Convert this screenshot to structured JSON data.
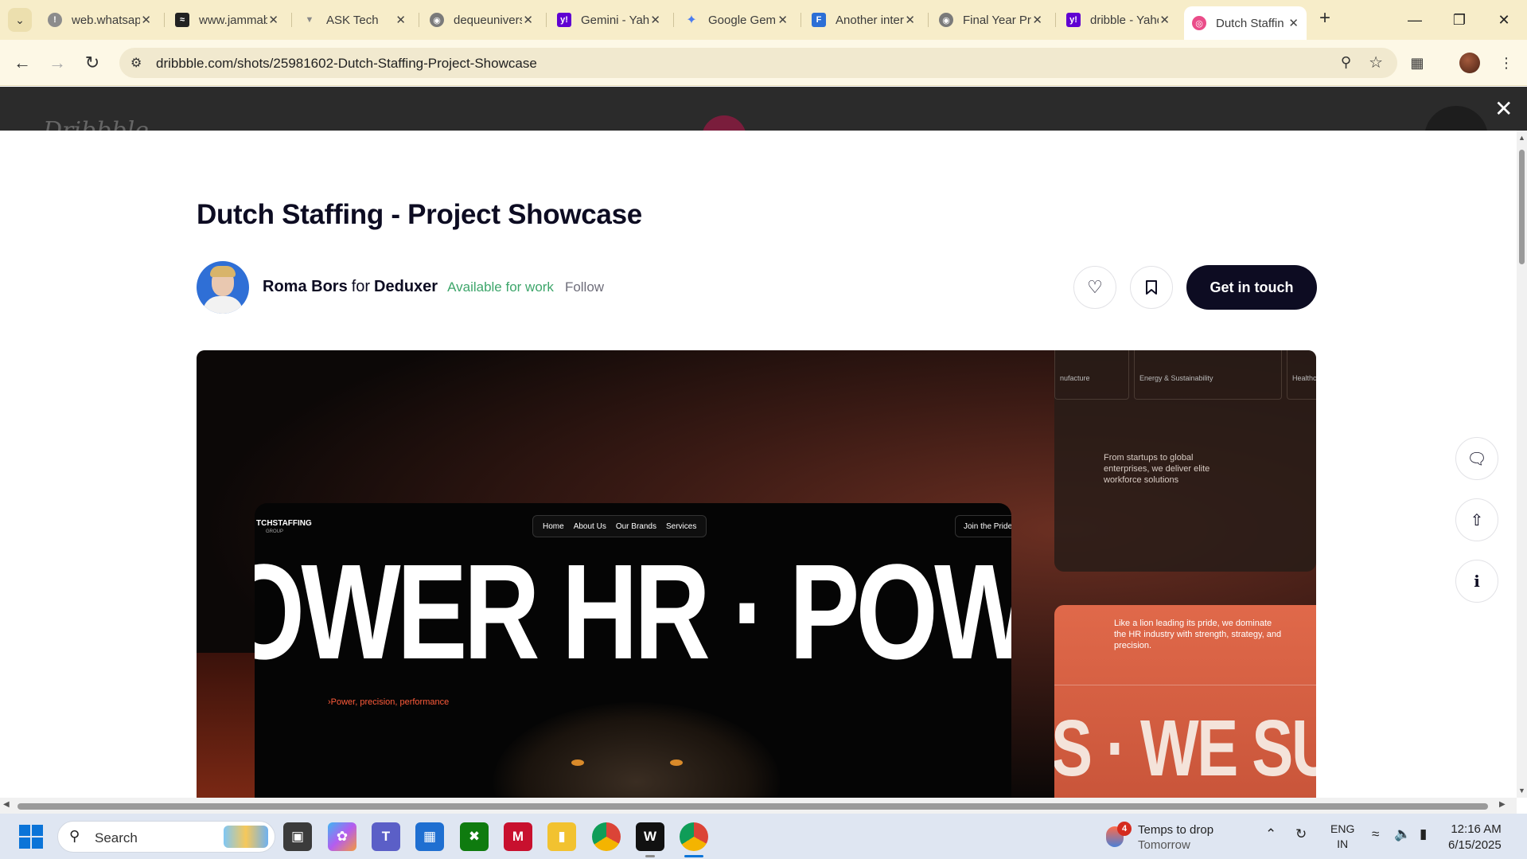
{
  "browser": {
    "tabs": [
      {
        "title": "web.whatsapp.com",
        "favicon_color": "#8c8c8c",
        "icon": "warning-icon"
      },
      {
        "title": "www.jammable",
        "favicon_color": "#222222",
        "icon": "wave-icon"
      },
      {
        "title": "ASK Tech",
        "favicon_color": "#9a9a9a",
        "icon": "filter-icon"
      },
      {
        "title": "dequeuniversity",
        "favicon_color": "#7a7a7a",
        "icon": "globe-icon"
      },
      {
        "title": "Gemini - Yahoo",
        "favicon_color": "#6001d2",
        "icon": "yahoo-icon"
      },
      {
        "title": "Google Gemini",
        "favicon_color": "#4a7cf0",
        "icon": "sparkle-icon"
      },
      {
        "title": "Another interview",
        "favicon_color": "#2c6fd6",
        "icon": "forms-icon"
      },
      {
        "title": "Final Year Project",
        "favicon_color": "#7a7a7a",
        "icon": "globe-icon"
      },
      {
        "title": "dribble - Yahoo",
        "favicon_color": "#6001d2",
        "icon": "yahoo-icon"
      },
      {
        "title": "Dutch Staffing",
        "favicon_color": "#ea4c89",
        "icon": "dribbble-icon",
        "active": true
      }
    ],
    "url": "dribbble.com/shots/25981602-Dutch-Staffing-Project-Showcase"
  },
  "shot": {
    "title": "Dutch Staffing - Project Showcase",
    "author": "Roma Bors",
    "for_word": "for",
    "team": "Deduxer",
    "availability": "Available for work",
    "follow": "Follow",
    "cta": "Get in touch"
  },
  "mockup": {
    "brand": "TCHSTAFFING",
    "brand_sub": "GROUP",
    "nav": [
      "Home",
      "About Us",
      "Our Brands",
      "Services"
    ],
    "join": "Join the Pride",
    "headline": "OWER HR · POW",
    "tagline": "›Power, precision, performance",
    "chips": [
      "nufacture",
      "Energy & Sustainability",
      "Healthcare"
    ],
    "card_top_copy": "From startups to global enterprises, we deliver elite workforce solutions",
    "card_orange_copy": "Like a lion leading its pride, we dominate the HR industry with strength, strategy, and precision.",
    "card_orange_headline": "S · WE SU"
  },
  "taskbar": {
    "search_placeholder": "Search",
    "weather_badge": "4",
    "weather_line1": "Temps to drop",
    "weather_line2": "Tomorrow",
    "lang1": "ENG",
    "lang2": "IN",
    "time": "12:16 AM",
    "date": "6/15/2025"
  },
  "colors": {
    "brand_dark": "#0d0c22",
    "available_green": "#3ea66b",
    "accent_orange": "#e0694a",
    "tabstrip": "#f7edc9"
  }
}
